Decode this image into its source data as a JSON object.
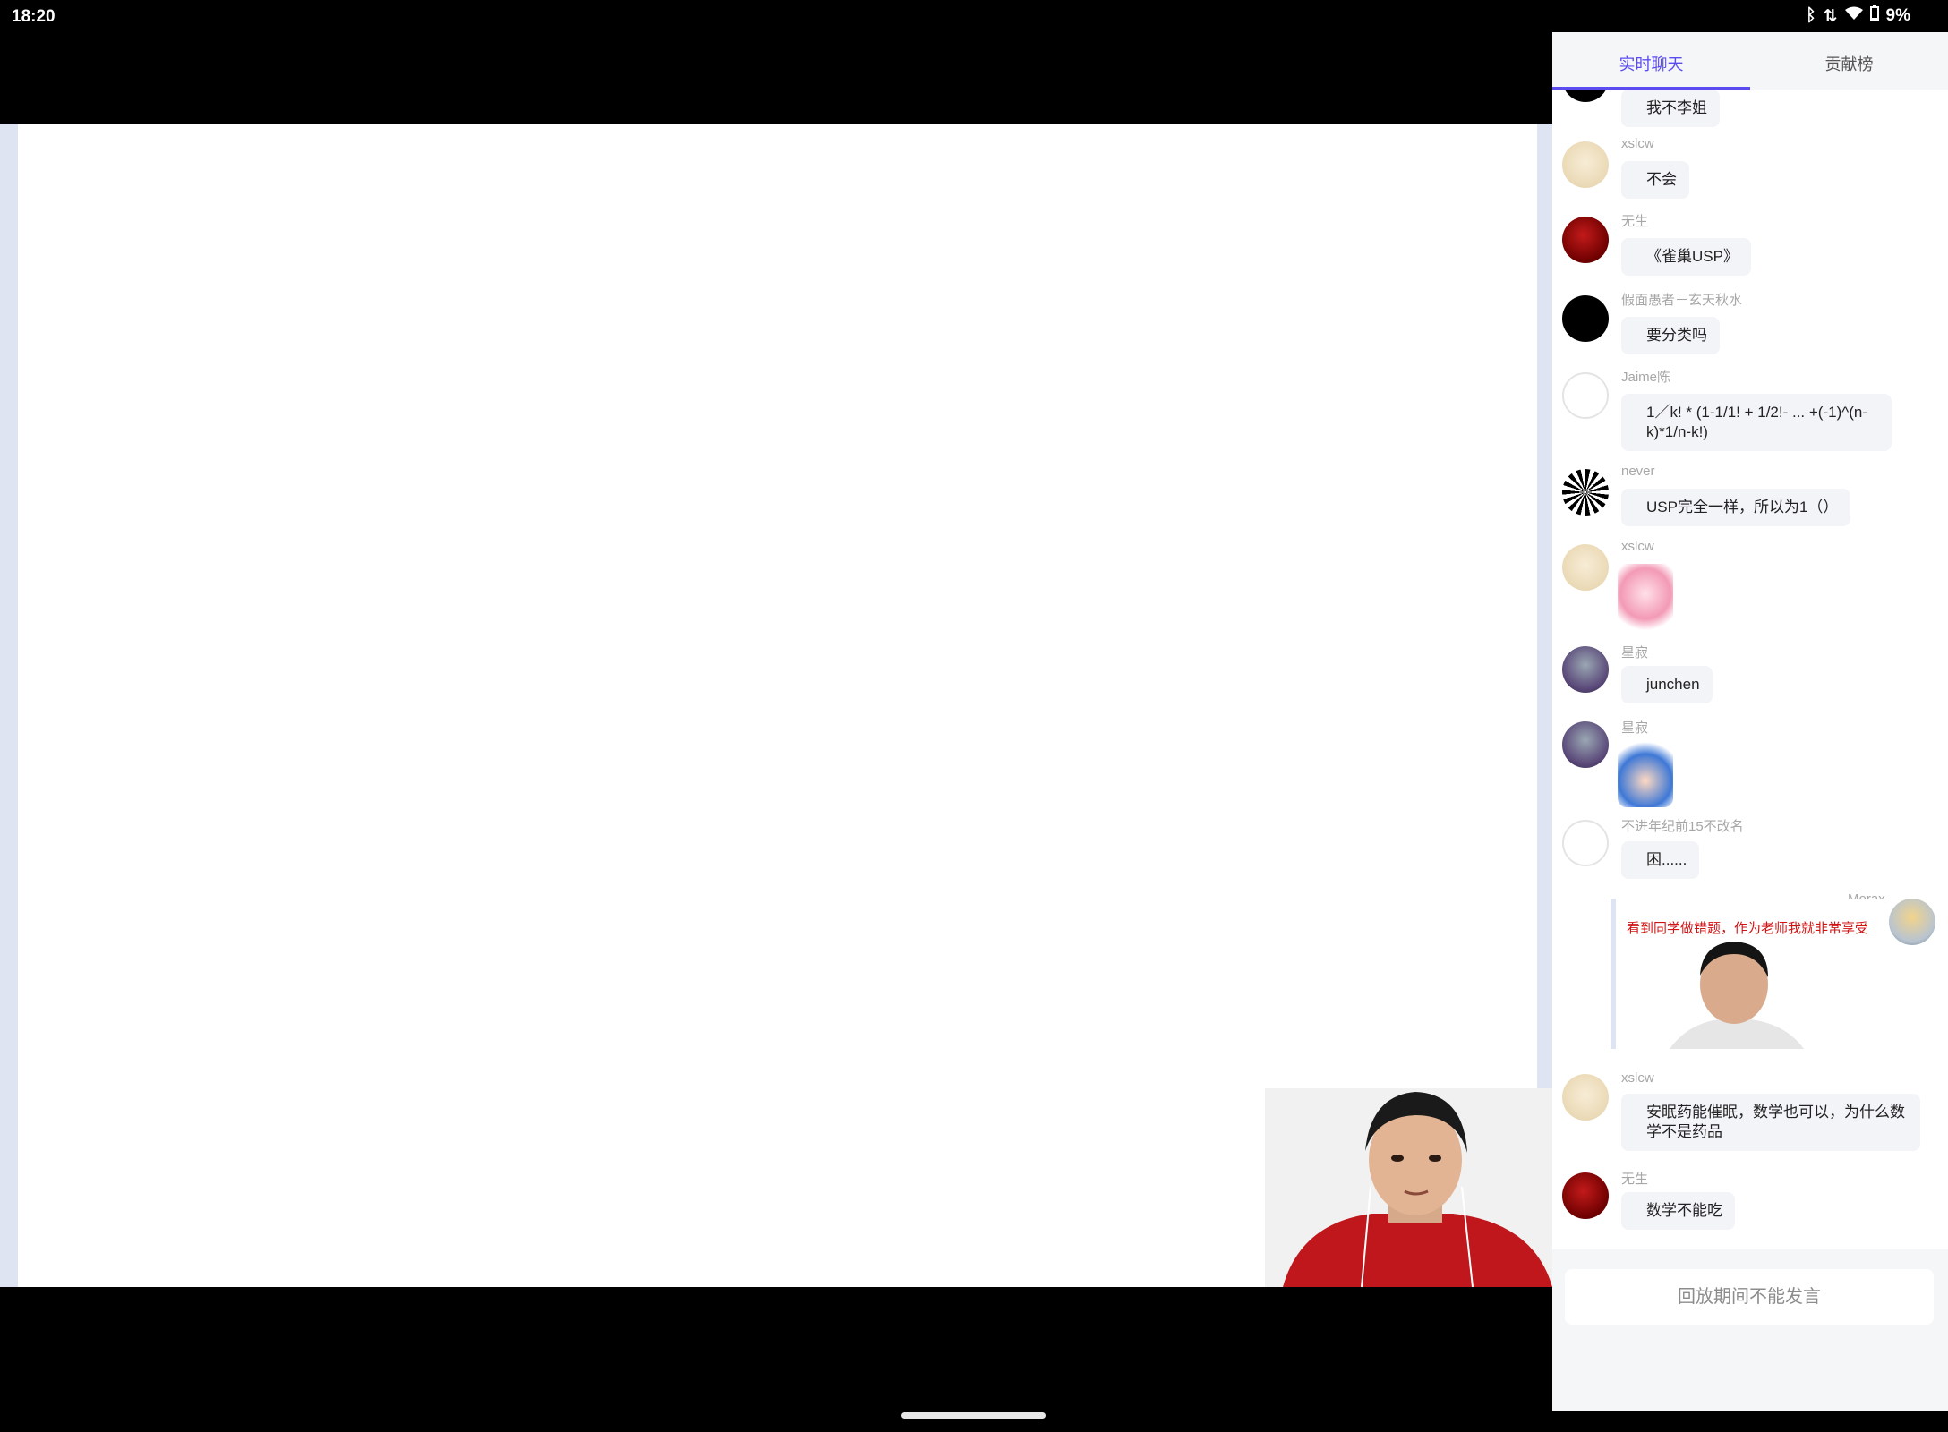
{
  "status_bar": {
    "time": "18:20",
    "battery": "9%"
  },
  "panel": {
    "tabs": [
      {
        "label": "实时聊天",
        "active": true
      },
      {
        "label": "贡献榜",
        "active": false
      }
    ],
    "messages": [
      {
        "avatar": "black-avatar",
        "user": "",
        "text": "我不李姐"
      },
      {
        "avatar": "sketch-avatar",
        "user": "xslcw",
        "text": "不会"
      },
      {
        "avatar": "red-avatar",
        "user": "无生",
        "text": "《雀巢USP》"
      },
      {
        "avatar": "black-avatar",
        "user": "假面愚者－玄天秋水",
        "text": "要分类吗"
      },
      {
        "avatar": "ghost-avatar",
        "user": "Jaime陈",
        "text": "1／k! * (1-1/1! + 1/2!- ... +(-1)^(n-k)*1/n-k!)"
      },
      {
        "avatar": "never-avatar",
        "user": "never",
        "text": "USP完全一样，所以为1（）"
      },
      {
        "avatar": "sketch-avatar",
        "user": "xslcw",
        "sticker": "pink-hair-anime-sticker"
      },
      {
        "avatar": "purple-avatar",
        "user": "星寂",
        "text": "junchen"
      },
      {
        "avatar": "purple-avatar",
        "user": "星寂",
        "sticker": "blue-hair-laughing-sticker"
      },
      {
        "avatar": "ghost-avatar",
        "user": "不进年纪前15不改名",
        "text": "困......"
      },
      {
        "avatar": "morax-avatar",
        "user": "Morax",
        "meme_caption": "看到同学做错题，作为老师我就非常享受"
      },
      {
        "avatar": "sketch-avatar",
        "user": "xslcw",
        "text": "安眠药能催眠，数学也可以，为什么数学不是药品"
      },
      {
        "avatar": "red-avatar",
        "user": "无生",
        "text": "数学不能吃"
      }
    ],
    "input_placeholder": "回放期间不能发言"
  }
}
